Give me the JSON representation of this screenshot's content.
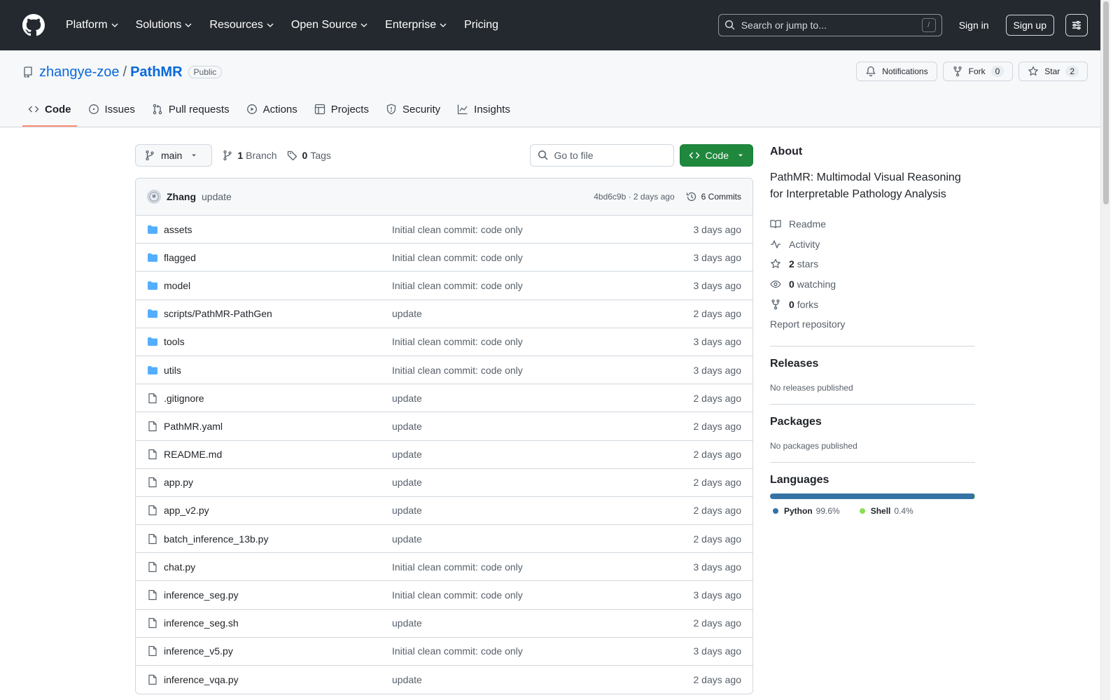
{
  "header": {
    "nav": [
      "Platform",
      "Solutions",
      "Resources",
      "Open Source",
      "Enterprise",
      "Pricing"
    ],
    "search_placeholder": "Search or jump to...",
    "search_shortcut": "/",
    "signin": "Sign in",
    "signup": "Sign up"
  },
  "repo": {
    "owner": "zhangye-zoe",
    "separator": "/",
    "name": "PathMR",
    "visibility": "Public",
    "notifications": "Notifications",
    "fork_label": "Fork",
    "fork_count": "0",
    "star_label": "Star",
    "star_count": "2",
    "tabs": [
      "Code",
      "Issues",
      "Pull requests",
      "Actions",
      "Projects",
      "Security",
      "Insights"
    ]
  },
  "toolbar": {
    "branch": "main",
    "branch_count": "1",
    "branch_label": "Branch",
    "tag_count": "0",
    "tag_label": "Tags",
    "goto_placeholder": "Go to file",
    "code_button": "Code"
  },
  "latest_commit": {
    "author": "Zhang",
    "message": "update",
    "meta": "4bd6c9b · 2 days ago",
    "commits": "6 Commits"
  },
  "files": [
    {
      "name": "assets",
      "type": "dir",
      "message": "Initial clean commit: code only",
      "time": "3 days ago"
    },
    {
      "name": "flagged",
      "type": "dir",
      "message": "Initial clean commit: code only",
      "time": "3 days ago"
    },
    {
      "name": "model",
      "type": "dir",
      "message": "Initial clean commit: code only",
      "time": "3 days ago"
    },
    {
      "name": "scripts/PathMR-PathGen",
      "type": "dir",
      "message": "update",
      "time": "2 days ago"
    },
    {
      "name": "tools",
      "type": "dir",
      "message": "Initial clean commit: code only",
      "time": "3 days ago"
    },
    {
      "name": "utils",
      "type": "dir",
      "message": "Initial clean commit: code only",
      "time": "3 days ago"
    },
    {
      "name": ".gitignore",
      "type": "file",
      "message": "update",
      "time": "2 days ago"
    },
    {
      "name": "PathMR.yaml",
      "type": "file",
      "message": "update",
      "time": "2 days ago"
    },
    {
      "name": "README.md",
      "type": "file",
      "message": "update",
      "time": "2 days ago"
    },
    {
      "name": "app.py",
      "type": "file",
      "message": "update",
      "time": "2 days ago"
    },
    {
      "name": "app_v2.py",
      "type": "file",
      "message": "update",
      "time": "2 days ago"
    },
    {
      "name": "batch_inference_13b.py",
      "type": "file",
      "message": "update",
      "time": "2 days ago"
    },
    {
      "name": "chat.py",
      "type": "file",
      "message": "Initial clean commit: code only",
      "time": "3 days ago"
    },
    {
      "name": "inference_seg.py",
      "type": "file",
      "message": "Initial clean commit: code only",
      "time": "3 days ago"
    },
    {
      "name": "inference_seg.sh",
      "type": "file",
      "message": "update",
      "time": "2 days ago"
    },
    {
      "name": "inference_v5.py",
      "type": "file",
      "message": "Initial clean commit: code only",
      "time": "3 days ago"
    },
    {
      "name": "inference_vqa.py",
      "type": "file",
      "message": "update",
      "time": "2 days ago"
    }
  ],
  "about": {
    "heading": "About",
    "description": "PathMR: Multimodal Visual Reasoning for Interpretable Pathology Analysis",
    "readme": "Readme",
    "activity": "Activity",
    "stars_count": "2",
    "stars_label": "stars",
    "watching_count": "0",
    "watching_label": "watching",
    "forks_count": "0",
    "forks_label": "forks",
    "report": "Report repository"
  },
  "releases": {
    "heading": "Releases",
    "empty": "No releases published"
  },
  "packages": {
    "heading": "Packages",
    "empty": "No packages published"
  },
  "languages": {
    "heading": "Languages",
    "items": [
      {
        "name": "Python",
        "percent": "99.6%",
        "value": 99.6,
        "color": "#3572A5"
      },
      {
        "name": "Shell",
        "percent": "0.4%",
        "value": 0.4,
        "color": "#89e051"
      }
    ]
  }
}
